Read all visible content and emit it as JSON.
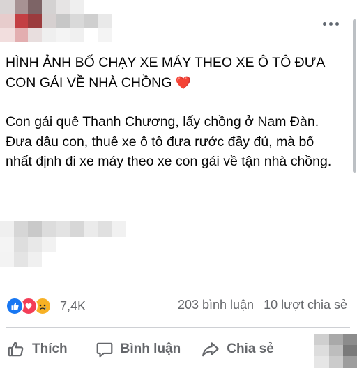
{
  "post": {
    "title": "HÌNH ẢNH BỐ CHẠY XE MÁY THEO XE Ô TÔ ĐƯA CON GÁI VỀ NHÀ CHỒNG",
    "heart_emoji": "❤️",
    "body": "Con gái quê Thanh Chương, lấy chồng ở Nam Đàn. Đưa dâu con, thuê xe ô tô đưa rước đầy đủ, mà bố nhất định đi xe máy theo xe con gái về tận nhà chồng."
  },
  "reactions": {
    "icons": [
      "like-reaction-icon",
      "love-reaction-icon",
      "sad-reaction-icon"
    ],
    "count": "7,4K"
  },
  "stats": {
    "comments": "203 bình luận",
    "shares": "10 lượt chia sẻ"
  },
  "actions": {
    "like": "Thích",
    "comment": "Bình luận",
    "share": "Chia sẻ"
  },
  "colors": {
    "secondary_text": "#65676b",
    "like_blue": "#1877f2",
    "love_red": "#f33e58",
    "sad_yellow": "#f7b125"
  }
}
